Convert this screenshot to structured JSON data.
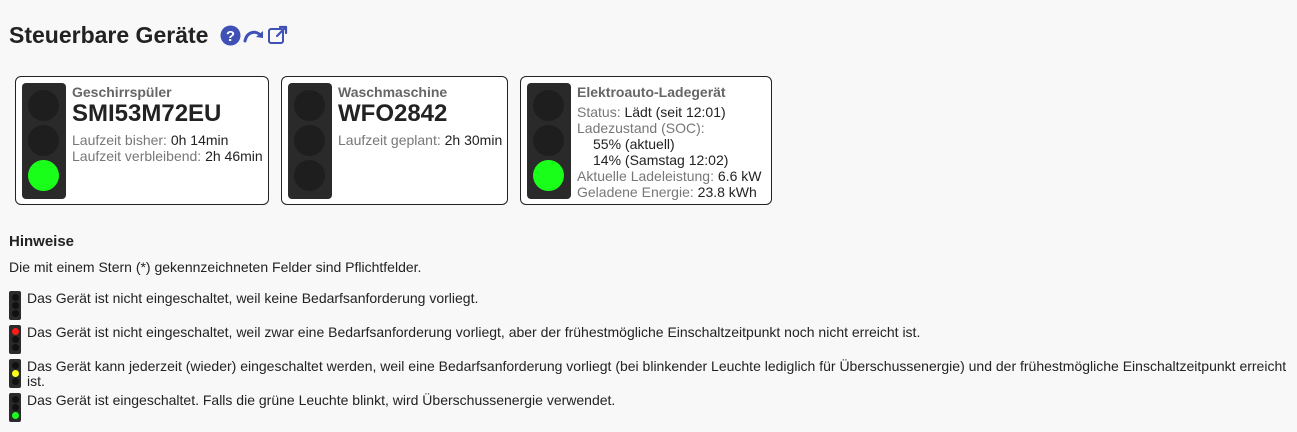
{
  "page": {
    "title": "Steuerbare Geräte",
    "icons": [
      "help-icon",
      "refresh-icon",
      "external-link-icon"
    ]
  },
  "devices": [
    {
      "type": "Geschirrspüler",
      "name": "SMI53M72EU",
      "light": "green",
      "rows": [
        {
          "label": "Laufzeit bisher:",
          "value": "0h 14min"
        },
        {
          "label": "Laufzeit verbleibend:",
          "value": "2h 46min"
        }
      ]
    },
    {
      "type": "Waschmaschine",
      "name": "WFO2842",
      "light": "off",
      "rows": [
        {
          "label": "Laufzeit geplant:",
          "value": "2h 30min"
        }
      ]
    },
    {
      "type": "Elektroauto-Ladegerät",
      "light": "green",
      "rows": [
        {
          "label": "Status:",
          "value": "Lädt (seit 12:01)"
        },
        {
          "label": "Ladezustand (SOC):",
          "value": ""
        },
        {
          "label": "",
          "value": "55% (aktuell)"
        },
        {
          "label": "",
          "value": "14% (Samstag 12:02)"
        },
        {
          "label": "Aktuelle Ladeleistung:",
          "value": "6.6 kW"
        },
        {
          "label": "Geladene Energie:",
          "value": "23.8 kWh"
        }
      ]
    }
  ],
  "hints": {
    "title": "Hinweise",
    "required_note": "Die mit einem Stern (*) gekennzeichneten Felder sind Pflichtfelder.",
    "items": [
      {
        "light": "off",
        "text": "Das Gerät ist nicht eingeschaltet, weil keine Bedarfsanforderung vorliegt."
      },
      {
        "light": "red",
        "text": "Das Gerät ist nicht eingeschaltet, weil zwar eine Bedarfsanforderung vorliegt, aber der frühestmögliche Einschaltzeitpunkt noch nicht erreicht ist."
      },
      {
        "light": "yellow",
        "text": "Das Gerät kann jederzeit (wieder) eingeschaltet werden, weil eine Bedarfsanforderung vorliegt (bei blinkender Leuchte lediglich für Überschussenergie) und der frühestmögliche Einschaltzeitpunkt erreicht ist."
      },
      {
        "light": "green",
        "text": "Das Gerät ist eingeschaltet. Falls die grüne Leuchte blinkt, wird Überschussenergie verwendet."
      }
    ]
  },
  "colors": {
    "green": "#1aff1a",
    "red": "#ff1a1a",
    "yellow": "#ffff1a",
    "link": "#3f51b5"
  }
}
